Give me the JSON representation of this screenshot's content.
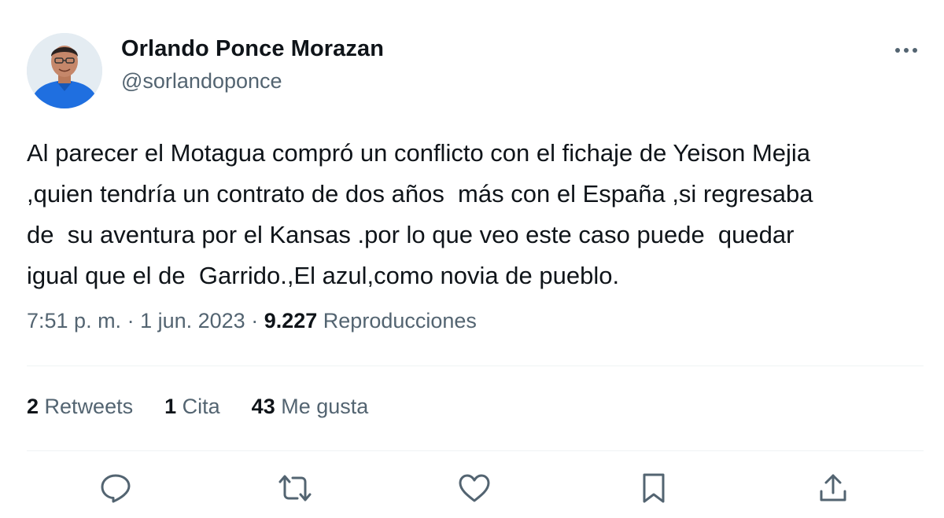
{
  "author": {
    "display_name": "Orlando Ponce Morazan",
    "handle": "@sorlandoponce"
  },
  "tweet": {
    "lines": [
      "Al parecer el Motagua compró un conflicto con el fichaje de Yeison Mejia",
      ",quien tendría un contrato de dos años  más con el España ,si regresaba",
      "de  su aventura por el Kansas .por lo que veo este caso puede  quedar",
      "igual que el de  Garrido.,El azul,como novia de pueblo."
    ]
  },
  "meta": {
    "time": "7:51 p. m.",
    "separator": " · ",
    "date": "1 jun. 2023",
    "views_count": "9.227",
    "views_label": "Reproducciones"
  },
  "stats": {
    "retweets_count": "2",
    "retweets_label": "Retweets",
    "quotes_count": "1",
    "quotes_label": "Cita",
    "likes_count": "43",
    "likes_label": "Me gusta"
  },
  "icons": {
    "more": "more-icon",
    "reply": "reply-icon",
    "retweet": "retweet-icon",
    "like": "heart-icon",
    "bookmark": "bookmark-icon",
    "share": "share-icon"
  },
  "colors": {
    "text_primary": "#0f1419",
    "text_secondary": "#536471",
    "divider": "#eff3f4",
    "icon": "#536471"
  }
}
